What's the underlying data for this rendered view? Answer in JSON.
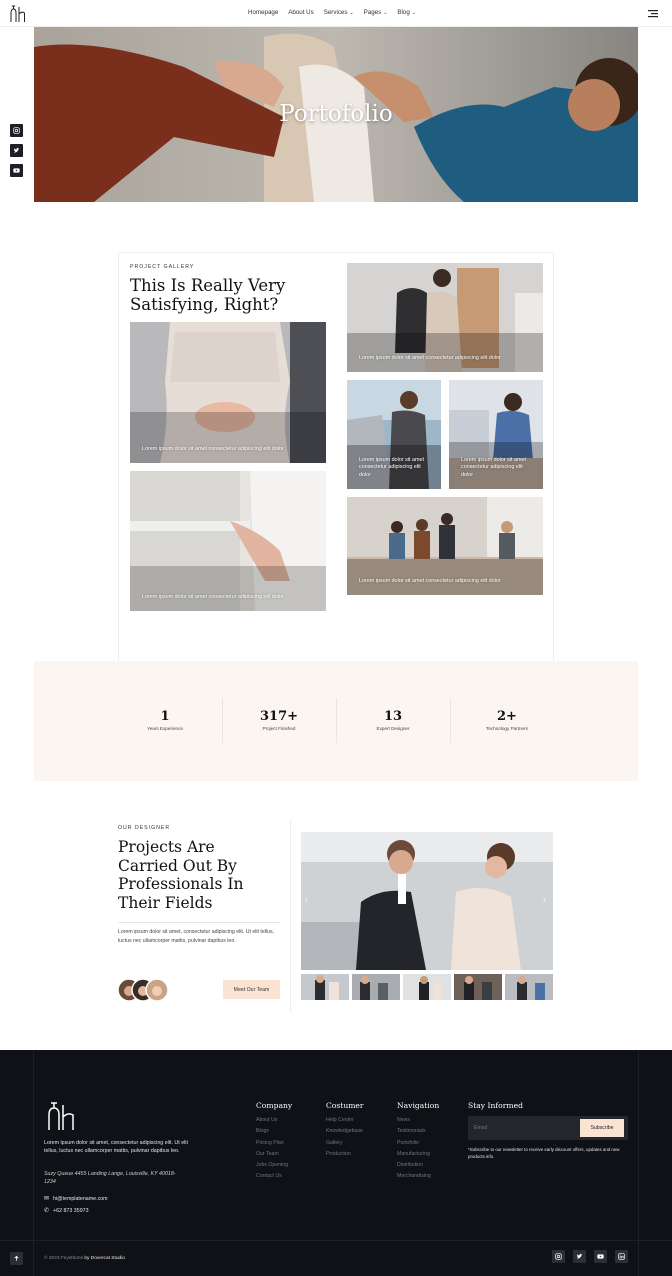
{
  "header": {
    "nav": [
      {
        "label": "Homepage",
        "dropdown": false
      },
      {
        "label": "About Us",
        "dropdown": false
      },
      {
        "label": "Services",
        "dropdown": true
      },
      {
        "label": "Pages",
        "dropdown": true
      },
      {
        "label": "Blog",
        "dropdown": true
      }
    ]
  },
  "hero": {
    "title": "Portofolio"
  },
  "social_left": [
    "instagram-icon",
    "twitter-icon",
    "youtube-icon"
  ],
  "gallery": {
    "kicker": "PROJECT GALLERY",
    "heading_line1": "This Is Really Very",
    "heading_line2": "Satisfying, Right?",
    "captions": {
      "large1": "Lorem ipsum dolor sit amet consectetur adipiscing elit dolor",
      "large2": "Lorem ipsum dolor sit amet consectetur adipiscing elit dolor",
      "right_top": "Lorem ipsum dolor sit amet consectetur adipiscing elit dolor",
      "right_mid1": "Lorem ipsum dolor sit amet consectetur adipiscing elit dolor",
      "right_mid2": "Lorem ipsum dolor sit amet consectetur adipiscing elit dolor",
      "right_bottom": "Lorem ipsum dolor sit amet consectetur adipiscing elit dolor"
    }
  },
  "stats": [
    {
      "number": "1",
      "label": "Years Experience"
    },
    {
      "number": "317+",
      "label": "Project Finished"
    },
    {
      "number": "13",
      "label": "Expert Designer"
    },
    {
      "number": "2+",
      "label": "Technology Partners"
    }
  ],
  "designer": {
    "kicker": "OUR DESIGNER",
    "heading": [
      "Projects Are",
      "Carried Out By",
      "Professionals In",
      "Their Fields"
    ],
    "text": "Lorem ipsum dolor sit amet, consectetur adipiscing elit. Ut elit tellus, luctus nec ullamcorper mattis, pulvinar dapibus leo.",
    "button": "Meet Our Team"
  },
  "footer": {
    "about": "Lorem ipsum dolor sit amet, consectetur adipiscing elit. Ut elit tellus, luctus nec ullamcorper mattis, pulvinar dapibus leo.",
    "address": "Suzy Queue 4455 Landing Lange, Louisville, KY 40018-1234",
    "email": "hi@templatename.com",
    "phone": "+62 873 35973",
    "columns": [
      {
        "title": "Company",
        "items": [
          "About Us",
          "Blogs",
          "Pricing Plan",
          "Our Team",
          "Jobs Opening",
          "Contact Us"
        ]
      },
      {
        "title": "Costumer",
        "items": [
          "Help Center",
          "Knowledgebase",
          "Gallery",
          "Production"
        ]
      },
      {
        "title": "Navigation",
        "items": [
          "News",
          "Testimonials",
          "Portofolio",
          "Manufacturing",
          "Distribution",
          "Merchandising"
        ]
      }
    ],
    "newsletter": {
      "title": "Stay Informed",
      "placeholder": "Email",
      "button": "Subscribe",
      "note": "*Subscribe to our newsletter to receive early discount offers, updates and new products info."
    },
    "copyright": "© 2023 Feysthons",
    "credit": "by Dovercat Studio",
    "social": [
      "instagram-icon",
      "twitter-icon",
      "youtube-icon",
      "linkedin-icon"
    ]
  },
  "colors": {
    "accent": "#fbe3d4",
    "dark": "#0e1116",
    "stats_bg": "#fbf6f2"
  }
}
